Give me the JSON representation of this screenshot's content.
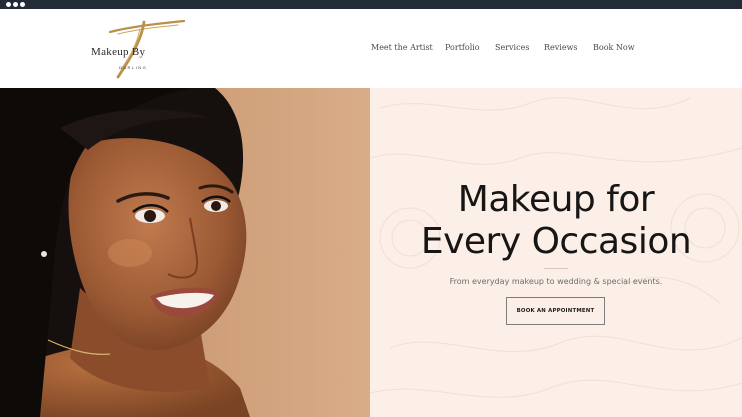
{
  "brand": {
    "logo_main": "Makeup By",
    "logo_sub": "DARLING",
    "logo_mark": "T",
    "gold": "#b8924a"
  },
  "nav": {
    "items": [
      {
        "label": "Meet the Artist"
      },
      {
        "label": "Portfolio"
      },
      {
        "label": "Services"
      },
      {
        "label": "Reviews"
      },
      {
        "label": "Book Now"
      }
    ]
  },
  "hero": {
    "heading_line1": "Makeup for",
    "heading_line2": "Every Occasion",
    "subheading": "From everyday makeup to wedding & special events.",
    "cta_label": "BOOK AN APPOINTMENT",
    "panel_color": "#fcefe7",
    "photo_backdrop": "#c89a75"
  },
  "chrome": {
    "bar_color": "#222b36"
  }
}
